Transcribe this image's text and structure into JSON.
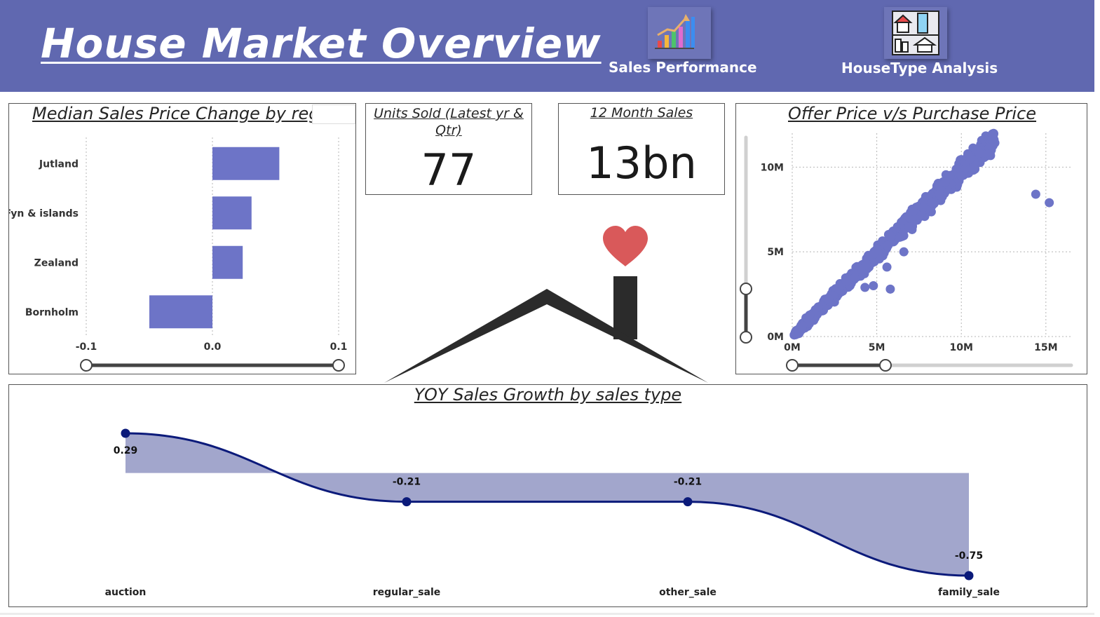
{
  "header": {
    "title": "House Market Overview",
    "nav": [
      {
        "label": "Sales Performance",
        "icon": "bar-chart-growth-icon"
      },
      {
        "label": "HouseType Analysis",
        "icon": "house-types-icon"
      }
    ]
  },
  "colors": {
    "header_bg": "#6068b0",
    "bar": "#6d74c7",
    "scatter": "#6d74c7",
    "line": "#0b1a7a",
    "area": "#a2a6cc",
    "heart": "#d9595a"
  },
  "kpis": {
    "units_sold": {
      "title": "Units Sold (Latest yr & Qtr)",
      "value": "77"
    },
    "month_sales": {
      "title": "12 Month Sales",
      "value": "13bn"
    }
  },
  "chart_data": [
    {
      "type": "bar",
      "orientation": "horizontal",
      "title": "Median Sales Price Change by reg",
      "categories": [
        "Jutland",
        "Fyn & islands",
        "Zealand",
        "Bornholm"
      ],
      "values": [
        0.053,
        0.031,
        0.024,
        -0.05
      ],
      "xlim": [
        -0.1,
        0.1
      ],
      "xticks": [
        "-0.1",
        "0.0",
        "0.1"
      ],
      "grid": true
    },
    {
      "type": "scatter",
      "title": "Offer Price v/s Purchase  Price",
      "xticks": [
        "0M",
        "5M",
        "10M",
        "15M"
      ],
      "yticks": [
        "0M",
        "5M",
        "10M"
      ],
      "xlim": [
        0,
        16.5
      ],
      "ylim": [
        0,
        12
      ],
      "trend": {
        "slope": 0.98,
        "spread": 0.5,
        "x_max": 12,
        "count": 900
      },
      "outliers": [
        [
          14.4,
          8.4
        ],
        [
          15.2,
          7.9
        ],
        [
          5.6,
          4.1
        ],
        [
          6.6,
          5.0
        ],
        [
          4.8,
          3.0
        ],
        [
          4.3,
          2.9
        ],
        [
          5.8,
          2.8
        ]
      ],
      "grid": true
    },
    {
      "type": "area",
      "title": "YOY Sales  Growth by sales  type",
      "categories": [
        "auction",
        "regular_sale",
        "other_sale",
        "family_sale"
      ],
      "values": [
        0.29,
        -0.21,
        -0.21,
        -0.75
      ],
      "data_labels": [
        "0.29",
        "-0.21",
        "-0.21",
        "-0.75"
      ],
      "baseline": 0,
      "ylim": [
        -0.75,
        0.29
      ]
    }
  ]
}
